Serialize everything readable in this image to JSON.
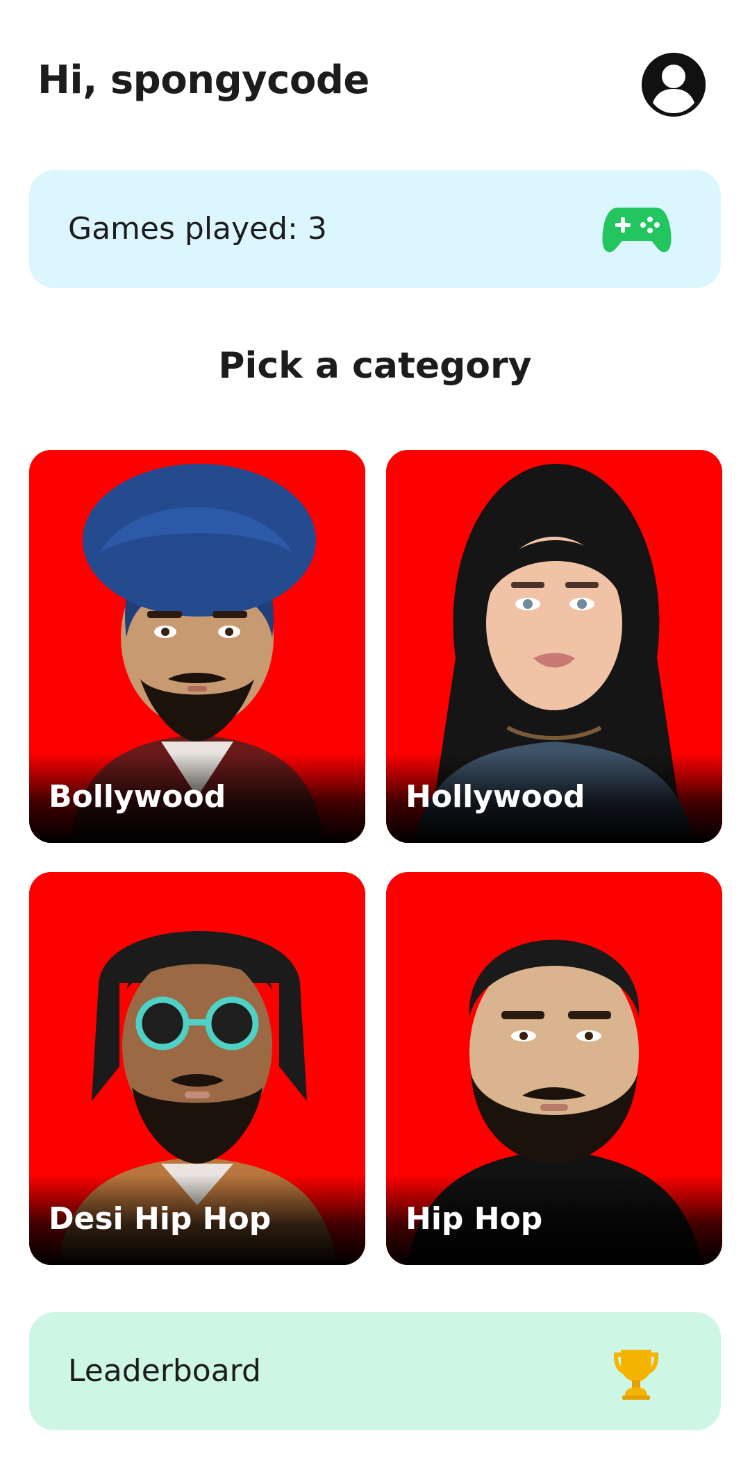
{
  "header": {
    "greeting": "Hi, spongycode",
    "profile_icon": "account-circle-icon"
  },
  "stats": {
    "label": "Games played: 3",
    "icon": "gamepad-icon",
    "icon_color": "#22c55e",
    "background": "#dbf6fc"
  },
  "section": {
    "title": "Pick a category"
  },
  "categories": [
    {
      "label": "Bollywood",
      "image": "illustrated portrait, man with blue turban"
    },
    {
      "label": "Hollywood",
      "image": "illustrated portrait, woman with long black hair"
    },
    {
      "label": "Desi Hip Hop",
      "image": "illustrated portrait, man with dreadlocks and round sunglasses"
    },
    {
      "label": "Hip Hop",
      "image": "illustrated portrait, man with short hair and beard"
    }
  ],
  "leaderboard": {
    "label": "Leaderboard",
    "icon": "trophy-icon",
    "icon_color": "#f5b400",
    "background": "#cdf6e4"
  },
  "colors": {
    "card_background": "#ff0000",
    "text_primary": "#1c1c1e"
  }
}
